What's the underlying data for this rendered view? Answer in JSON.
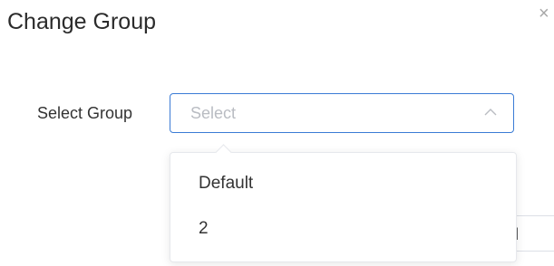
{
  "dialog": {
    "title": "Change Group",
    "close_symbol": "×"
  },
  "form": {
    "group_label": "Select Group",
    "select_placeholder": "Select"
  },
  "dropdown": {
    "options": [
      {
        "label": "Default"
      },
      {
        "label": "2"
      }
    ]
  },
  "footer": {
    "cancel_label_partial": "cel"
  },
  "colors": {
    "accent_border": "#3a7bd5",
    "placeholder_text": "#b9bcc2",
    "text": "#333333"
  },
  "icons": {
    "close": "close-icon",
    "select_open": "chevron-up-icon"
  }
}
